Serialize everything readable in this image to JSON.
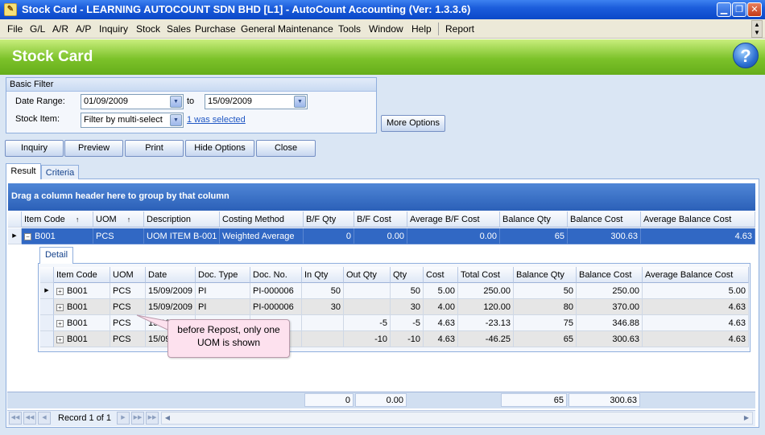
{
  "window": {
    "title": "Stock Card - LEARNING AUTOCOUNT SDN BHD [L1] - AutoCount Accounting (Ver: 1.3.3.6)"
  },
  "menu": [
    {
      "label": "File"
    },
    {
      "label": "G/L"
    },
    {
      "label": "A/R"
    },
    {
      "label": "A/P"
    },
    {
      "label": "Inquiry"
    },
    {
      "label": "Stock"
    },
    {
      "label": "Sales"
    },
    {
      "label": "Purchase"
    },
    {
      "label": "General Maintenance"
    },
    {
      "label": "Tools"
    },
    {
      "label": "Window"
    },
    {
      "label": "Help"
    },
    {
      "label": "Report"
    }
  ],
  "header": {
    "title": "Stock Card",
    "help_icon": "?"
  },
  "filter": {
    "legend": "Basic Filter",
    "date_range_label": "Date Range:",
    "date_from": "01/09/2009",
    "to_label": "to",
    "date_to": "15/09/2009",
    "stock_item_label": "Stock Item:",
    "stock_item_value": "Filter by multi-select",
    "selected_link": "1 was selected",
    "more_options": "More Options"
  },
  "toolbar": {
    "inquiry": "Inquiry",
    "preview": "Preview",
    "print": "Print",
    "hide_options": "Hide Options",
    "close": "Close"
  },
  "tabs": {
    "result": "Result",
    "criteria": "Criteria"
  },
  "grid": {
    "group_hint": "Drag a column header here to group by that column",
    "columns": [
      "Item Code",
      "UOM",
      "Description",
      "Costing Method",
      "B/F Qty",
      "B/F Cost",
      "Average B/F Cost",
      "Balance Qty",
      "Balance Cost",
      "Average Balance Cost"
    ],
    "row": [
      "B001",
      "PCS",
      "UOM ITEM B-001",
      "Weighted Average",
      "0",
      "0.00",
      "0.00",
      "65",
      "300.63",
      "4.63"
    ]
  },
  "detail": {
    "tab": "Detail",
    "columns": [
      "Item Code",
      "UOM",
      "Date",
      "Doc. Type",
      "Doc. No.",
      "In Qty",
      "Out Qty",
      "Qty",
      "Cost",
      "Total Cost",
      "Balance Qty",
      "Balance Cost",
      "Average Balance Cost"
    ],
    "rows": [
      [
        "B001",
        "PCS",
        "15/09/2009",
        "PI",
        "PI-000006",
        "50",
        "",
        "50",
        "5.00",
        "250.00",
        "50",
        "250.00",
        "5.00"
      ],
      [
        "B001",
        "PCS",
        "15/09/2009",
        "PI",
        "PI-000006",
        "30",
        "",
        "30",
        "4.00",
        "120.00",
        "80",
        "370.00",
        "4.63"
      ],
      [
        "B001",
        "PCS",
        "15/09/2009",
        "",
        "",
        "",
        "-5",
        "-5",
        "4.63",
        "-23.13",
        "75",
        "346.88",
        "4.63"
      ],
      [
        "B001",
        "PCS",
        "15/09/2009",
        "",
        "",
        "",
        "-10",
        "-10",
        "4.63",
        "-46.25",
        "65",
        "300.63",
        "4.63"
      ]
    ]
  },
  "summary": {
    "bf_qty": "0",
    "bf_cost": "0.00",
    "balance_qty": "65",
    "balance_cost": "300.63"
  },
  "navigator": {
    "record_text": "Record 1 of 1"
  },
  "callout": {
    "text": "before Repost, only one UOM is shown"
  }
}
